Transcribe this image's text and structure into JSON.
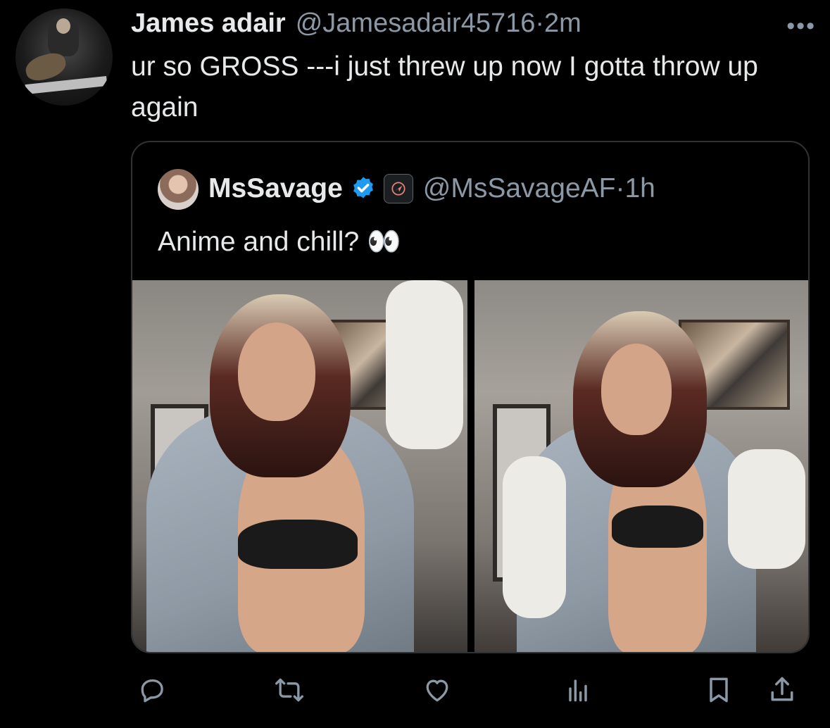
{
  "tweet": {
    "author_name": "James adair",
    "author_handle": "@Jamesadair45716",
    "separator": "·",
    "time": "2m",
    "more_label": "•••",
    "text": "ur so GROSS ---i just threw up now I gotta throw up again"
  },
  "quoted": {
    "author_name": "MsSavage",
    "verified_icon": "verified-badge-icon",
    "affiliate_icon": "affiliate-badge-icon",
    "author_handle": "@MsSavageAF",
    "separator": "·",
    "time": "1h",
    "text": "Anime and chill? 👀",
    "images": [
      "photo-1",
      "photo-2"
    ]
  },
  "actions": [
    "reply-icon",
    "retweet-icon",
    "like-icon",
    "views-icon",
    "bookmark-icon",
    "share-icon"
  ],
  "colors": {
    "background": "#000000",
    "text": "#e7e9ea",
    "secondary": "#8b98a5",
    "verified": "#1d9bf0",
    "border": "#2f3336"
  }
}
